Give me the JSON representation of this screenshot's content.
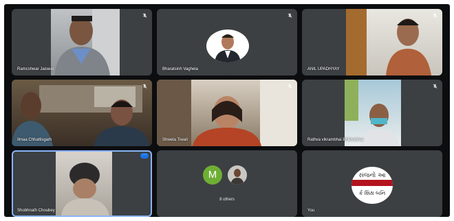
{
  "tiles": [
    {
      "name": "Ramcshwar Jaiswal"
    },
    {
      "name": "Bharatsinh Vaghela"
    },
    {
      "name": "ANIL UPADHYAY"
    },
    {
      "name": "Ilmaa Chhattisgarh"
    },
    {
      "name": "Shweta Tiwari"
    },
    {
      "name": "Rathva vikrambhai Bhikhabhai"
    },
    {
      "name": "Shobhnath Choubey"
    },
    {
      "name": "8 others",
      "avatar_letter": "M"
    },
    {
      "name": "You",
      "logo_text": [
        "સંજનો આ",
        "ર્ક શિક્ષ બનિ"
      ]
    }
  ],
  "colors": {
    "background": "#0c0d0f",
    "tile": "#3c4043",
    "active_border": "#8ab4f8",
    "avatar_green": "#6fae34"
  },
  "icons": [
    "mic-off-icon",
    "more-options-icon"
  ]
}
